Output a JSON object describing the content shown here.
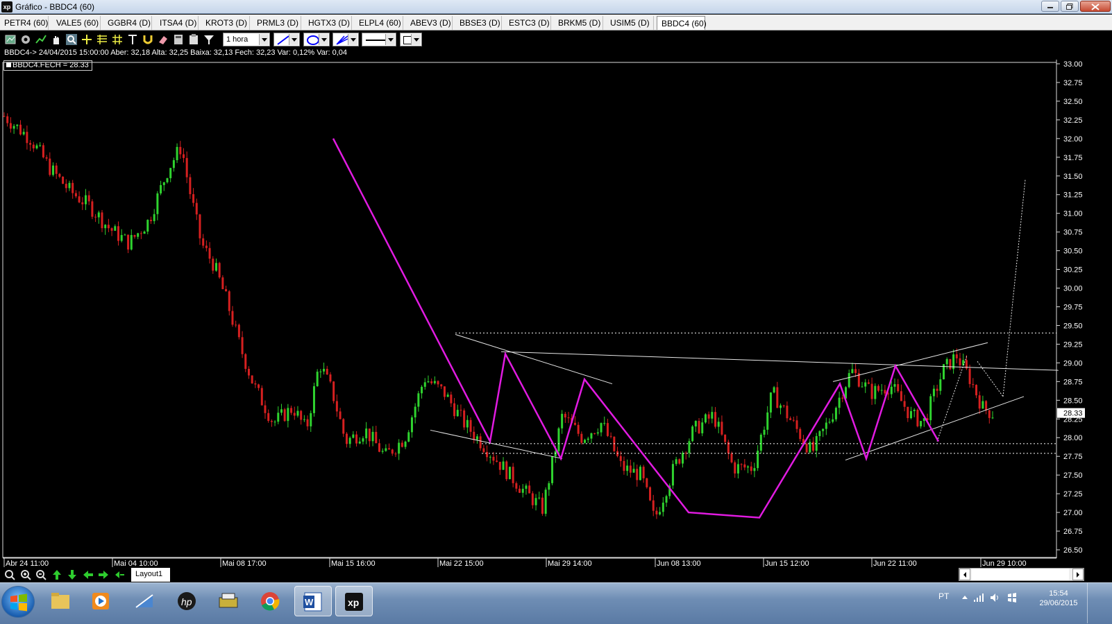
{
  "window": {
    "title": "Gráfico - BBDC4 (60)",
    "logo": "xp"
  },
  "tabs": [
    {
      "label": "PETR4 (60)"
    },
    {
      "label": "VALE5 (60)"
    },
    {
      "label": "GGBR4 (D)"
    },
    {
      "label": "ITSA4 (D)"
    },
    {
      "label": "KROT3 (D)"
    },
    {
      "label": "PRML3 (D)"
    },
    {
      "label": "HGTX3 (D)"
    },
    {
      "label": "ELPL4 (60)"
    },
    {
      "label": "ABEV3 (D)"
    },
    {
      "label": "BBSE3 (D)"
    },
    {
      "label": "ESTC3 (D)"
    },
    {
      "label": "BRKM5 (D)"
    },
    {
      "label": "USIM5 (D)"
    },
    {
      "label": "BBDC4 (60)",
      "active": true
    }
  ],
  "toolbar": {
    "icons": [
      "chart-type-icon",
      "settings-gear-icon",
      "studies-icon",
      "hand-pan-icon",
      "zoom-tool-icon",
      "crosshair-icon",
      "fibonacci-icon",
      "grid-icon",
      "text-tool-icon",
      "magnet-icon",
      "eraser-icon",
      "calculator-icon",
      "clipboard-icon",
      "filter-icon"
    ],
    "period": "1 hora",
    "line_tool": "trend-line-icon",
    "shape_tool": "ellipse-icon",
    "fan_tool": "fan-line-icon",
    "line_style": "solid-line-icon"
  },
  "quote_info": "BBDC4-> 24/04/2015 15:00:00 Aber: 32,18 Alta: 32,25 Baixa: 32,13 Fech: 32,23 Var: 0,12% Var: 0,04",
  "legend": "BBDC4.FECH = 28.33",
  "chart_data": {
    "type": "candlestick",
    "symbol": "BBDC4",
    "interval": "1 hora",
    "y_ticks": [
      "33.00",
      "32.75",
      "32.50",
      "32.25",
      "32.00",
      "31.75",
      "31.50",
      "31.25",
      "31.00",
      "30.75",
      "30.50",
      "30.25",
      "30.00",
      "29.75",
      "29.50",
      "29.25",
      "29.00",
      "28.75",
      "28.50",
      "28.25",
      "28.00",
      "27.75",
      "27.50",
      "27.25",
      "27.00",
      "26.75",
      "26.50"
    ],
    "ylim": [
      26.5,
      33.0
    ],
    "x_ticks": [
      "Abr 24 11:00",
      "Mai 04 10:00",
      "Mai 08 17:00",
      "Mai 15 16:00",
      "Mai 22 15:00",
      "Mai 29 14:00",
      "Jun 08 13:00",
      "Jun 15 12:00",
      "Jun 22 11:00",
      "Jun 29 10:00"
    ],
    "last_price": "28.33",
    "price_path": [
      [
        0,
        32.3
      ],
      [
        8,
        32.0
      ],
      [
        14,
        31.6
      ],
      [
        20,
        31.3
      ],
      [
        26,
        31.1
      ],
      [
        32,
        30.8
      ],
      [
        38,
        30.6
      ],
      [
        44,
        30.9
      ],
      [
        50,
        31.6
      ],
      [
        54,
        31.9
      ],
      [
        56,
        31.4
      ],
      [
        60,
        30.6
      ],
      [
        64,
        30.3
      ],
      [
        68,
        29.8
      ],
      [
        72,
        29.2
      ],
      [
        76,
        28.7
      ],
      [
        82,
        28.2
      ],
      [
        88,
        28.4
      ],
      [
        92,
        28.1
      ],
      [
        96,
        29.0
      ],
      [
        100,
        28.6
      ],
      [
        104,
        27.95
      ],
      [
        110,
        28.1
      ],
      [
        116,
        27.75
      ],
      [
        122,
        28.0
      ],
      [
        128,
        28.8
      ],
      [
        134,
        28.6
      ],
      [
        140,
        28.2
      ],
      [
        146,
        27.9
      ],
      [
        152,
        27.6
      ],
      [
        158,
        27.3
      ],
      [
        164,
        27.05
      ],
      [
        170,
        28.3
      ],
      [
        176,
        28.0
      ],
      [
        182,
        28.2
      ],
      [
        188,
        27.6
      ],
      [
        194,
        27.5
      ],
      [
        198,
        26.9
      ],
      [
        204,
        27.6
      ],
      [
        210,
        28.1
      ],
      [
        216,
        28.3
      ],
      [
        222,
        27.6
      ],
      [
        228,
        27.6
      ],
      [
        234,
        28.6
      ],
      [
        240,
        28.2
      ],
      [
        246,
        27.8
      ],
      [
        252,
        28.3
      ],
      [
        258,
        28.9
      ],
      [
        264,
        28.6
      ],
      [
        270,
        28.7
      ],
      [
        276,
        28.3
      ],
      [
        280,
        28.2
      ],
      [
        286,
        28.9
      ],
      [
        290,
        29.1
      ],
      [
        294,
        28.8
      ],
      [
        298,
        28.4
      ],
      [
        302,
        28.3
      ]
    ],
    "zigzag": [
      [
        0,
        32.0,
        54
      ],
      [
        0,
        27.95,
        104
      ],
      [
        0,
        29.1,
        109
      ],
      [
        0,
        27.7,
        124
      ],
      [
        0,
        28.8,
        137
      ],
      [
        0,
        27.0,
        163
      ],
      [
        0,
        26.9,
        179
      ],
      [
        0,
        28.7,
        202
      ],
      [
        0,
        27.7,
        208
      ],
      [
        0,
        28.95,
        220
      ],
      [
        0,
        28.0,
        232
      ]
    ],
    "resistance_level": 29.4,
    "support_levels": [
      27.92,
      27.79
    ],
    "neckline": [
      [
        109,
        29.15
      ],
      [
        256,
        28.9
      ]
    ],
    "channel": [
      [
        208,
        27.7
      ],
      [
        270,
        28.4
      ]
    ],
    "target": 31.45
  },
  "bottom": {
    "icons": [
      "zoom-reset-icon",
      "zoom-in-icon",
      "zoom-out-icon",
      "arrow-up-icon",
      "arrow-down-icon",
      "arrow-left-icon",
      "arrow-right-icon",
      "arrow-end-icon"
    ],
    "layout_tab": "Layout1"
  },
  "taskbar": {
    "apps": [
      "file-explorer-icon",
      "media-player-icon",
      "network-icon",
      "hp-icon",
      "scanner-icon",
      "chrome-icon",
      "word-icon",
      "xp-icon"
    ],
    "language": "PT",
    "time": "15:54",
    "date": "29/06/2015"
  }
}
